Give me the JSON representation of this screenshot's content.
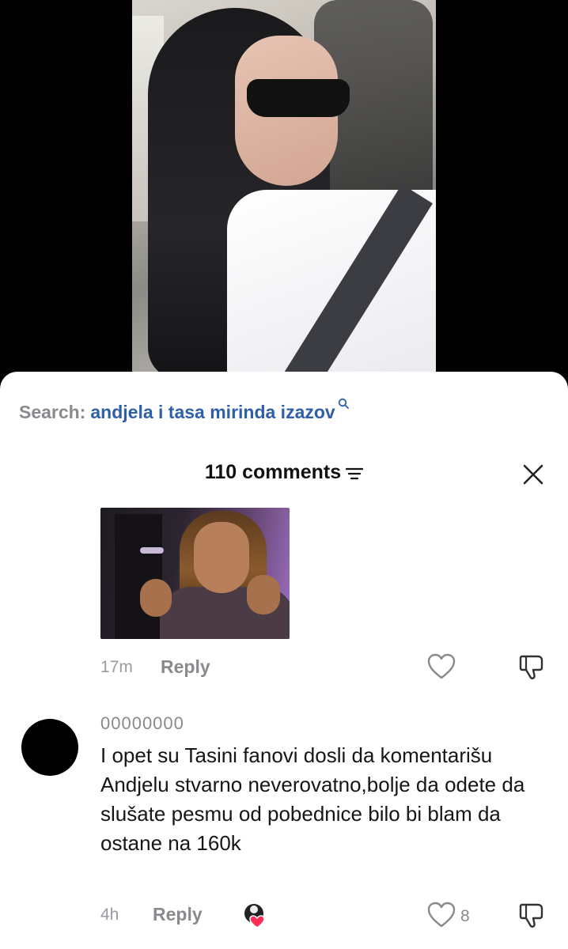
{
  "search": {
    "label": "Search:",
    "query": "andjela i tasa mirinda izazov"
  },
  "comments_panel": {
    "count_label": "110 comments",
    "comments": [
      {
        "type": "sticker",
        "time": "17m",
        "reply_label": "Reply"
      },
      {
        "username": "00000000",
        "text": "I opet su Tasini fanovi dosli da komentarišu Andjelu stvarno neverovatno,bolje da odete da slušate pesmu od pobednice bilo bi blam da ostane na 160k",
        "time": "4h",
        "reply_label": "Reply",
        "likes": "8"
      }
    ]
  },
  "colors": {
    "query_blue": "#2f5fa8",
    "muted_gray": "#8a8a8e",
    "liked_heart": "#ff2d55"
  }
}
